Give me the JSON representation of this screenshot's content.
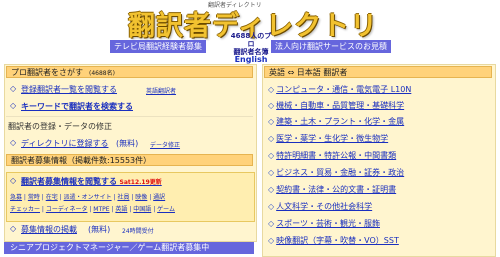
{
  "header": {
    "tagline": "翻訳者ディレクトリ",
    "logo": "翻訳者ディレクトリ",
    "left_button": "テレビ局翻訳経験者募集",
    "right_button": "法人向け翻訳サービスのお見積",
    "center_info_line1": "4688人のプロ",
    "center_info_line2": "翻訳者名簿",
    "center_info_english": "English"
  },
  "left": {
    "find_head": "プロ翻訳者をさがす",
    "find_count": "(4688名)",
    "browse_link": "登録翻訳者一覧を閲覧する",
    "browse_en": "英語翻訳者",
    "search_link": "キーワードで翻訳者を検索する",
    "register_head": "翻訳者の登録・データの修正",
    "register_link": "ディレクトリに登録する",
    "register_note": "(無料)",
    "edit_link": "データ修正",
    "jobs_head": "翻訳者募集情報（掲載件数:15553件）",
    "jobs_link": "翻訳者募集情報を閲覧する",
    "jobs_update": "Sat12.19更新",
    "job_tags_line1": [
      "急募",
      "常時",
      "在宅",
      "派遣・オンサイト",
      "社員",
      "映像",
      "通訳"
    ],
    "job_tags_line2": [
      "チェッカー",
      "コーディネータ",
      "MTPE",
      "英語",
      "中国語",
      "ゲーム"
    ],
    "post_link": "募集情報の掲載",
    "post_note": "(無料)",
    "post_time": "24時間受付",
    "bottom_bar": "シニアプロジェクトマネージャー／ゲーム翻訳者募集中"
  },
  "right": {
    "head": "英語 ⇔ 日本語 翻訳者",
    "categories": [
      "コンピュータ・通信・電気電子 L10N",
      "機械・自動車・品質管理・基礎科学",
      "建築・土木・プラント・化学・金属",
      "医学・薬学・生化学・微生物学",
      "特許明細書・特許公報・中間書類",
      "ビジネス・貿易・金融・証券・政治",
      "契約書・法律・公的文書・証明書",
      "人文科学・その他社会科学",
      "スポーツ・芸術・観光・服飾",
      "映像翻訳（字幕・吹替・VO）SST"
    ]
  },
  "colors": {
    "link": "#1a2fbf",
    "panel_bg": "#fff5cf",
    "head_bg": "#ffd27a",
    "button_bg": "#6666dd",
    "alert": "#e01010"
  }
}
